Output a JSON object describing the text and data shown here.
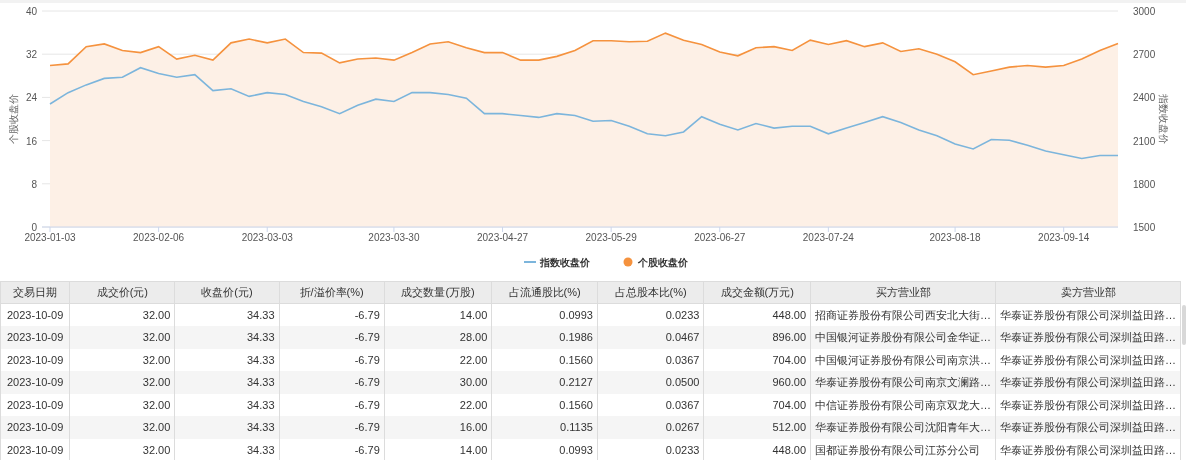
{
  "chart": {
    "chart_data": {
      "type": "line",
      "grid": true,
      "legend": "bottom",
      "ylabel": "个股收盘价",
      "y2label": "指数收盘价",
      "categories": [
        "2023-01-03",
        null,
        null,
        null,
        null,
        null,
        "2023-02-06",
        null,
        null,
        null,
        null,
        null,
        "2023-03-03",
        null,
        null,
        null,
        null,
        null,
        null,
        "2023-03-30",
        null,
        null,
        null,
        null,
        null,
        "2023-04-27",
        null,
        null,
        null,
        null,
        null,
        "2023-05-29",
        null,
        null,
        null,
        null,
        null,
        "2023-06-27",
        null,
        null,
        null,
        null,
        null,
        "2023-07-24",
        null,
        null,
        null,
        null,
        null,
        null,
        "2023-08-18",
        null,
        null,
        null,
        null,
        null,
        "2023-09-14",
        null,
        null,
        null
      ],
      "ylim": [
        0,
        40
      ],
      "yticks": [
        0,
        8,
        16,
        24,
        32,
        40
      ],
      "y2lim": [
        1500,
        3000
      ],
      "y2ticks": [
        1500,
        1800,
        2100,
        2400,
        2700,
        3000
      ],
      "series": [
        {
          "name": "指数收盘价",
          "color": "#7cb5dc",
          "axis": "y2",
          "values": [
            2354,
            2433,
            2487,
            2532,
            2540,
            2606,
            2566,
            2540,
            2558,
            2447,
            2460,
            2407,
            2433,
            2420,
            2372,
            2335,
            2287,
            2346,
            2388,
            2372,
            2433,
            2433,
            2420,
            2394,
            2287,
            2287,
            2274,
            2261,
            2287,
            2274,
            2234,
            2240,
            2200,
            2147,
            2134,
            2160,
            2266,
            2213,
            2174,
            2219,
            2187,
            2200,
            2200,
            2147,
            2187,
            2226,
            2266,
            2226,
            2174,
            2134,
            2076,
            2042,
            2108,
            2102,
            2068,
            2028,
            2002,
            1976,
            1997,
            1997
          ]
        },
        {
          "name": "个股收盘价",
          "color": "#f5923e",
          "values": [
            29.9,
            30.2,
            33.4,
            33.9,
            32.7,
            32.3,
            33.4,
            31.1,
            31.8,
            30.9,
            34.1,
            34.8,
            34.1,
            34.8,
            32.3,
            32.2,
            30.4,
            31.1,
            31.3,
            30.9,
            32.3,
            33.9,
            34.3,
            33.2,
            32.3,
            32.3,
            30.9,
            30.9,
            31.6,
            32.7,
            34.5,
            34.5,
            34.3,
            34.4,
            35.9,
            34.6,
            33.8,
            32.4,
            31.7,
            33.2,
            33.4,
            32.7,
            34.6,
            33.8,
            34.5,
            33.4,
            34.1,
            32.5,
            33.0,
            32.0,
            30.6,
            28.2,
            28.9,
            29.6,
            29.9,
            29.6,
            29.9,
            31.1,
            32.7,
            34.0
          ]
        }
      ]
    }
  },
  "table": {
    "columns": [
      {
        "label": "交易日期",
        "kind": "date"
      },
      {
        "label": "成交价(元)",
        "kind": "number"
      },
      {
        "label": "收盘价(元)",
        "kind": "number"
      },
      {
        "label": "折/溢价率(%)",
        "kind": "number"
      },
      {
        "label": "成交数量(万股)",
        "kind": "number"
      },
      {
        "label": "占流通股比(%)",
        "kind": "number"
      },
      {
        "label": "占总股本比(%)",
        "kind": "number"
      },
      {
        "label": "成交金额(万元)",
        "kind": "number"
      },
      {
        "label": "买方营业部",
        "kind": "text"
      },
      {
        "label": "卖方营业部",
        "kind": "text"
      }
    ],
    "rows": [
      [
        "2023-10-09",
        "32.00",
        "34.33",
        "-6.79",
        "14.00",
        "0.0993",
        "0.0233",
        "448.00",
        "招商证券股份有限公司西安北大街…",
        "华泰证券股份有限公司深圳益田路…"
      ],
      [
        "2023-10-09",
        "32.00",
        "34.33",
        "-6.79",
        "28.00",
        "0.1986",
        "0.0467",
        "896.00",
        "中国银河证券股份有限公司金华证…",
        "华泰证券股份有限公司深圳益田路…"
      ],
      [
        "2023-10-09",
        "32.00",
        "34.33",
        "-6.79",
        "22.00",
        "0.1560",
        "0.0367",
        "704.00",
        "中国银河证券股份有限公司南京洪…",
        "华泰证券股份有限公司深圳益田路…"
      ],
      [
        "2023-10-09",
        "32.00",
        "34.33",
        "-6.79",
        "30.00",
        "0.2127",
        "0.0500",
        "960.00",
        "华泰证券股份有限公司南京文澜路…",
        "华泰证券股份有限公司深圳益田路…"
      ],
      [
        "2023-10-09",
        "32.00",
        "34.33",
        "-6.79",
        "22.00",
        "0.1560",
        "0.0367",
        "704.00",
        "中信证券股份有限公司南京双龙大…",
        "华泰证券股份有限公司深圳益田路…"
      ],
      [
        "2023-10-09",
        "32.00",
        "34.33",
        "-6.79",
        "16.00",
        "0.1135",
        "0.0267",
        "512.00",
        "华泰证券股份有限公司沈阳青年大…",
        "华泰证券股份有限公司深圳益田路…"
      ],
      [
        "2023-10-09",
        "32.00",
        "34.33",
        "-6.79",
        "14.00",
        "0.0993",
        "0.0233",
        "448.00",
        "国都证券股份有限公司江苏分公司",
        "华泰证券股份有限公司深圳益田路…"
      ]
    ]
  }
}
